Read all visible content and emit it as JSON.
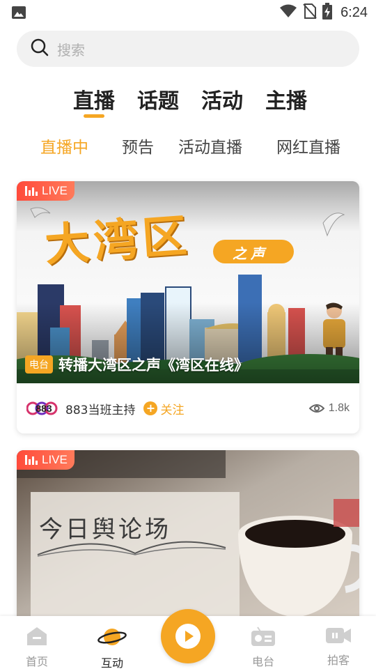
{
  "status_bar": {
    "time": "6:24"
  },
  "search": {
    "placeholder": "搜索"
  },
  "main_tabs": [
    {
      "label": "直播",
      "active": true
    },
    {
      "label": "话题",
      "active": false
    },
    {
      "label": "活动",
      "active": false
    },
    {
      "label": "主播",
      "active": false
    }
  ],
  "sub_tabs": [
    {
      "label": "直播中",
      "active": true
    },
    {
      "label": "预告",
      "active": false
    },
    {
      "label": "活动直播",
      "active": false
    },
    {
      "label": "网红直播",
      "active": false
    }
  ],
  "cards": [
    {
      "live_label": "LIVE",
      "image_title": "大湾区",
      "image_subtitle": "之声",
      "tag": "电台",
      "caption": "转播大湾区之声《湾区在线》",
      "host_logo": "883",
      "host_name": "883当班主持",
      "follow_label": "关注",
      "views": "1.8k"
    },
    {
      "live_label": "LIVE",
      "image_title": "今日舆论场"
    }
  ],
  "bottom_nav": [
    {
      "label": "首页",
      "icon": "home-icon",
      "active": false
    },
    {
      "label": "互动",
      "icon": "planet-icon",
      "active": true
    },
    {
      "label": "",
      "icon": "play-icon",
      "active": false
    },
    {
      "label": "电台",
      "icon": "radio-icon",
      "active": false
    },
    {
      "label": "拍客",
      "icon": "video-camera-icon",
      "active": false
    }
  ],
  "colors": {
    "accent": "#f5a623",
    "live": "#ff4b3b"
  }
}
